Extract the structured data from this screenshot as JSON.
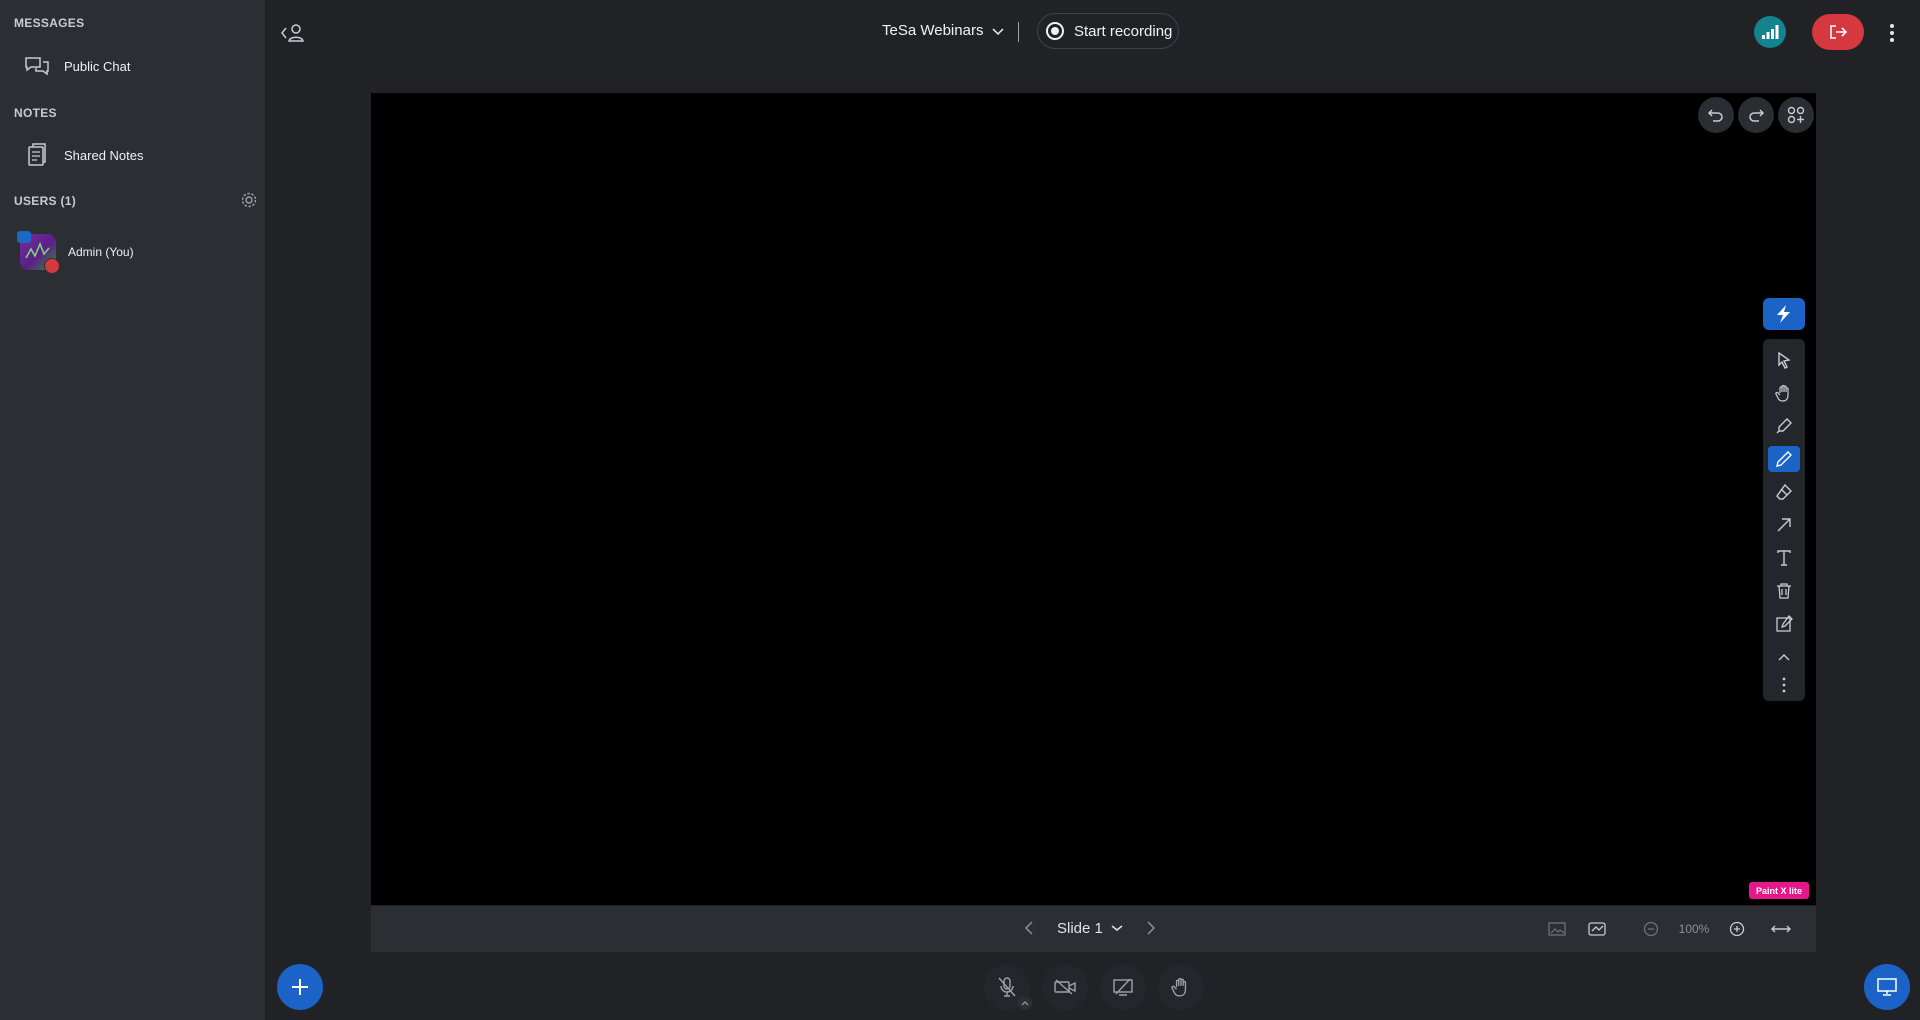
{
  "sidebar": {
    "messages_title": "MESSAGES",
    "public_chat": "Public Chat",
    "notes_title": "NOTES",
    "shared_notes": "Shared Notes",
    "users_title": "USERS (1)",
    "user_name": "Admin (You)"
  },
  "topbar": {
    "meeting_title": "TeSa Webinars",
    "record_label": "Start recording"
  },
  "presentation": {
    "slide_label": "Slide 1",
    "zoom_level": "100%",
    "badge": "Paint X lite"
  },
  "colors": {
    "primary": "#1b63c6",
    "danger": "#d5383e",
    "connection": "#14838d",
    "badge": "#e6178a"
  }
}
